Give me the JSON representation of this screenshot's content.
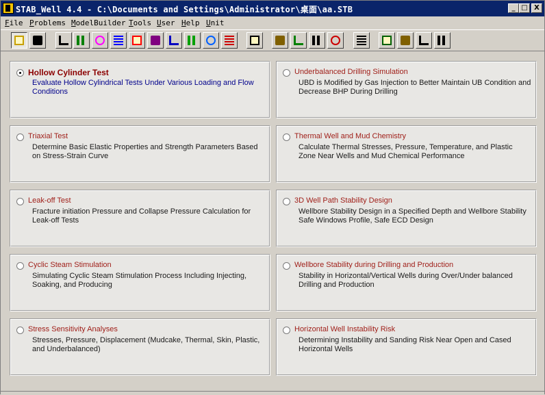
{
  "window": {
    "title": "STAB_Well 4.4 - C:\\Documents and Settings\\Administrator\\桌面\\aa.STB",
    "controls": {
      "minimize": "_",
      "maximize": "□",
      "close": "X"
    }
  },
  "menu": [
    {
      "label_pre": "",
      "label_u": "F",
      "label_post": "ile"
    },
    {
      "label_pre": "",
      "label_u": "P",
      "label_post": "roblems"
    },
    {
      "label_pre": "",
      "label_u": "M",
      "label_post": "odelBuilder"
    },
    {
      "label_pre": "",
      "label_u": "T",
      "label_post": "ools"
    },
    {
      "label_pre": "",
      "label_u": "U",
      "label_post": "ser"
    },
    {
      "label_pre": "",
      "label_u": "H",
      "label_post": "elp"
    },
    {
      "label_pre": "",
      "label_u": "U",
      "label_post": "nit"
    }
  ],
  "toolbar": [
    {
      "icon": "open-folder-icon",
      "color": "#c8a000"
    },
    {
      "icon": "save-icon",
      "color": "#000000"
    },
    {
      "icon": "cylinder-icon",
      "color": "#000000"
    },
    {
      "icon": "triaxial-icon",
      "color": "#008000"
    },
    {
      "icon": "curve-icon",
      "color": "#ff00ff"
    },
    {
      "icon": "bars-icon",
      "color": "#0000ff"
    },
    {
      "icon": "multi-line-icon",
      "color": "#ff0000"
    },
    {
      "icon": "plot-icon",
      "color": "#800080"
    },
    {
      "icon": "column-chart-icon",
      "color": "#0000c0"
    },
    {
      "icon": "stripes-icon",
      "color": "#00a000"
    },
    {
      "icon": "triangle-icon",
      "color": "#0060ff"
    },
    {
      "icon": "wave-icon",
      "color": "#cc0000"
    },
    {
      "icon": "magnifier-icon",
      "color": "#000000"
    },
    {
      "icon": "cross-icon",
      "color": "#806000"
    },
    {
      "icon": "split-icon",
      "color": "#008000"
    },
    {
      "icon": "document-icon",
      "color": "#000000"
    },
    {
      "icon": "arrow-icon",
      "color": "#cc0000"
    },
    {
      "icon": "person-icon",
      "color": "#000000"
    },
    {
      "icon": "book-icon",
      "color": "#006000"
    },
    {
      "icon": "open-book-icon",
      "color": "#806000"
    },
    {
      "icon": "list-icon",
      "color": "#000000"
    },
    {
      "icon": "erase-icon",
      "color": "#000000"
    }
  ],
  "options": [
    {
      "title": "Hollow Cylinder Test",
      "desc": "Evaluate Hollow Cylindrical Tests Under Various Loading and Flow Conditions",
      "selected": true
    },
    {
      "title": "Underbalanced Drilling Simulation",
      "desc": "UBD is Modified by Gas Injection to Better Maintain UB Condition and Decrease BHP During Drilling",
      "selected": false
    },
    {
      "title": "Triaxial Test",
      "desc": "Determine Basic Elastic Properties and Strength Parameters Based on Stress-Strain Curve",
      "selected": false
    },
    {
      "title": "Thermal Well and Mud Chemistry",
      "desc": "Calculate Thermal Stresses, Pressure, Temperature, and Plastic Zone Near Wells and Mud Chemical Performance",
      "selected": false
    },
    {
      "title": "Leak-off Test",
      "desc": "Fracture initiation Pressure and Collapse Pressure Calculation for Leak-off Tests",
      "selected": false
    },
    {
      "title": "3D Well Path Stability Design",
      "desc": "Wellbore Stability Design in a Specified Depth and Wellbore Stability Safe Windows Profile, Safe ECD Design",
      "selected": false
    },
    {
      "title": "Cyclic Steam Stimulation",
      "desc": "Simulating Cyclic Steam Stimulation Process Including Injecting, Soaking, and Producing",
      "selected": false
    },
    {
      "title": "Wellbore Stability during Drilling and Production",
      "desc": "Stability in Horizontal/Vertical Wells during Over/Under balanced Drilling and Production",
      "selected": false
    },
    {
      "title": "Stress Sensitivity Analyses",
      "desc": "Stresses, Pressure, Displacement (Mudcake, Thermal, Skin, Plastic, and Underbalanced)",
      "selected": false
    },
    {
      "title": "Horizontal Well Instability Risk",
      "desc": "Determining Instability and Sanding Risk Near Open and Cased Horizontal Wells",
      "selected": false
    }
  ]
}
